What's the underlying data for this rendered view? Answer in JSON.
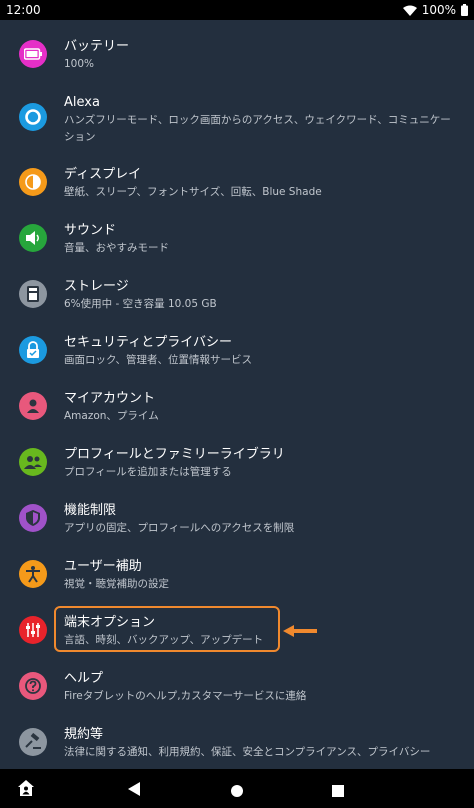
{
  "status_bar": {
    "time": "12:00",
    "battery": "100%",
    "icons": [
      "wifi-icon",
      "battery-icon"
    ]
  },
  "settings": [
    {
      "title": "バッテリー",
      "subtitle": "100%",
      "icon": "battery-icon",
      "color": "#e52fc7"
    },
    {
      "title": "Alexa",
      "subtitle": "ハンズフリーモード、ロック画面からのアクセス、ウェイクワード、コミュニケーション",
      "icon": "alexa-icon",
      "color": "#1b9ae0"
    },
    {
      "title": "ディスプレイ",
      "subtitle": "壁紙、スリープ、フォントサイズ、回転、Blue Shade",
      "icon": "display-icon",
      "color": "#f59a1a"
    },
    {
      "title": "サウンド",
      "subtitle": "音量、おやすみモード",
      "icon": "speaker-icon",
      "color": "#27a63c"
    },
    {
      "title": "ストレージ",
      "subtitle": "6%使用中 - 空き容量 10.05 GB",
      "icon": "storage-icon",
      "color": "#8d96a0"
    },
    {
      "title": "セキュリティとプライバシー",
      "subtitle": "画面ロック、管理者、位置情報サービス",
      "icon": "lock-icon",
      "color": "#1b9ae0"
    },
    {
      "title": "マイアカウント",
      "subtitle": "Amazon、プライム",
      "icon": "account-icon",
      "color": "#e8587c"
    },
    {
      "title": "プロフィールとファミリーライブラリ",
      "subtitle": "プロフィールを追加または管理する",
      "icon": "people-icon",
      "color": "#68b81e"
    },
    {
      "title": "機能制限",
      "subtitle": "アプリの固定、プロフィールへのアクセスを制限",
      "icon": "shield-icon",
      "color": "#a052c9"
    },
    {
      "title": "ユーザー補助",
      "subtitle": "視覚・聴覚補助の設定",
      "icon": "accessibility-icon",
      "color": "#f59a1a"
    },
    {
      "title": "端末オプション",
      "subtitle": "言語、時刻、バックアップ、アップデート",
      "icon": "sliders-icon",
      "color": "#e8232b"
    },
    {
      "title": "ヘルプ",
      "subtitle": "Fireタブレットのヘルプ,カスタマーサービスに連絡",
      "icon": "help-icon",
      "color": "#e8587c"
    },
    {
      "title": "規約等",
      "subtitle": "法律に関する通知、利用規約、保証、安全とコンプライアンス、プライバシー",
      "icon": "gavel-icon",
      "color": "#8d96a0"
    }
  ],
  "annotation": {
    "highlight_color": "#f0892e",
    "highlighted_item": "端末オプション"
  },
  "nav_bar": {
    "buttons": [
      "home-profile-icon",
      "back-icon",
      "home-icon",
      "recents-icon"
    ]
  }
}
